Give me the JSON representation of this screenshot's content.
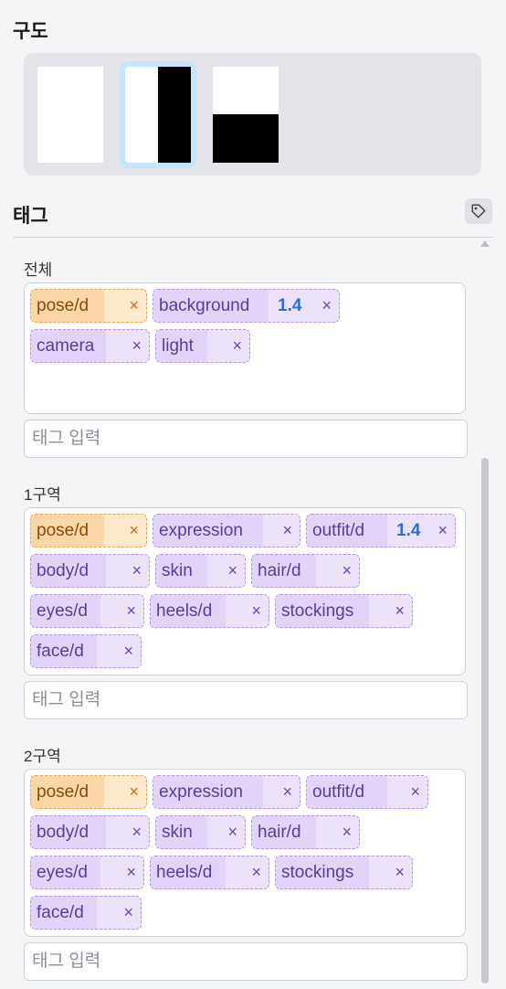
{
  "composition": {
    "title": "구도",
    "options": [
      "full",
      "split-vertical",
      "split-horizontal"
    ],
    "selected": "split-vertical"
  },
  "tags": {
    "title": "태그",
    "icon": "tag-icon",
    "input_placeholder": "태그 입력",
    "sections": [
      {
        "label": "전체",
        "chips": [
          {
            "text": "pose/d",
            "style": "orange"
          },
          {
            "text": "background",
            "weight": "1.4"
          },
          {
            "text": "camera"
          },
          {
            "text": "light"
          }
        ]
      },
      {
        "label": "1구역",
        "chips": [
          {
            "text": "pose/d",
            "style": "orange"
          },
          {
            "text": "expression"
          },
          {
            "text": "outfit/d",
            "weight": "1.4"
          },
          {
            "text": "body/d"
          },
          {
            "text": "skin"
          },
          {
            "text": "hair/d"
          },
          {
            "text": "eyes/d"
          },
          {
            "text": "heels/d"
          },
          {
            "text": "stockings"
          },
          {
            "text": "face/d"
          }
        ]
      },
      {
        "label": "2구역",
        "chips": [
          {
            "text": "pose/d",
            "style": "orange"
          },
          {
            "text": "expression"
          },
          {
            "text": "outfit/d"
          },
          {
            "text": "body/d"
          },
          {
            "text": "skin"
          },
          {
            "text": "hair/d"
          },
          {
            "text": "eyes/d"
          },
          {
            "text": "heels/d"
          },
          {
            "text": "stockings"
          },
          {
            "text": "face/d"
          }
        ]
      }
    ],
    "remove_symbol": "×"
  }
}
